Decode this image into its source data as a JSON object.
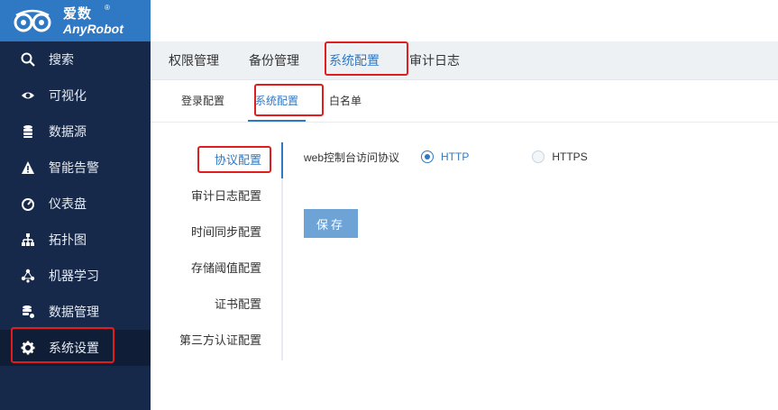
{
  "brand": {
    "name_cn": "爱数",
    "name_en": "AnyRobot",
    "reg_mark": "®",
    "bar_color": "#2f78c4",
    "sidebar_color": "#17294a"
  },
  "sidebar": {
    "items": [
      {
        "label": "搜索",
        "icon": "search-icon"
      },
      {
        "label": "可视化",
        "icon": "eye-icon"
      },
      {
        "label": "数据源",
        "icon": "database-icon"
      },
      {
        "label": "智能告警",
        "icon": "warning-icon"
      },
      {
        "label": "仪表盘",
        "icon": "gauge-icon"
      },
      {
        "label": "拓扑图",
        "icon": "topology-icon"
      },
      {
        "label": "机器学习",
        "icon": "network-icon"
      },
      {
        "label": "数据管理",
        "icon": "data-manage-icon"
      },
      {
        "label": "系统设置",
        "icon": "gear-icon",
        "active": true
      }
    ]
  },
  "tabs": [
    {
      "label": "权限管理"
    },
    {
      "label": "备份管理"
    },
    {
      "label": "系统配置",
      "active": true
    },
    {
      "label": "审计日志"
    }
  ],
  "subtabs": [
    {
      "label": "登录配置"
    },
    {
      "label": "系统配置",
      "active": true
    },
    {
      "label": "白名单"
    }
  ],
  "side_menu": [
    {
      "label": "协议配置",
      "active": true
    },
    {
      "label": "审计日志配置"
    },
    {
      "label": "时间同步配置"
    },
    {
      "label": "存储阈值配置"
    },
    {
      "label": "证书配置"
    },
    {
      "label": "第三方认证配置"
    }
  ],
  "form": {
    "label": "web控制台访问协议",
    "options": [
      {
        "label": "HTTP",
        "selected": true
      },
      {
        "label": "HTTPS",
        "selected": false
      }
    ],
    "save_label": "保存"
  },
  "accent_color": "#2f78c4",
  "highlight_color": "#e21d1d"
}
